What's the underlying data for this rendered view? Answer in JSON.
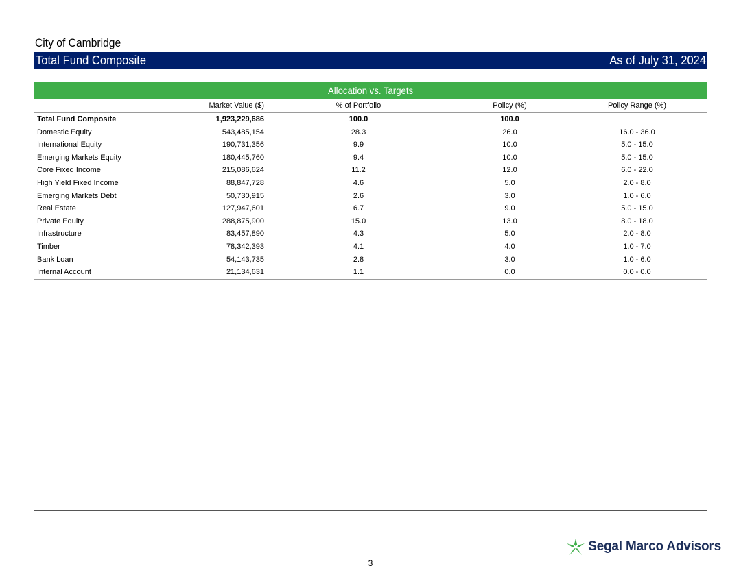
{
  "header": {
    "client_name": "City of Cambridge",
    "title": "Total Fund Composite",
    "as_of": "As of July 31, 2024"
  },
  "allocation": {
    "section_title": "Allocation vs. Targets",
    "columns": [
      "",
      "Market Value ($)",
      "% of Portfolio",
      "Policy (%)",
      "Policy Range (%)"
    ],
    "total": {
      "name": "Total Fund Composite",
      "market_value": "1,923,229,686",
      "pct_portfolio": "100.0",
      "policy": "100.0",
      "range": ""
    },
    "rows": [
      {
        "name": "Domestic Equity",
        "market_value": "543,485,154",
        "pct_portfolio": "28.3",
        "policy": "26.0",
        "range": "16.0 - 36.0"
      },
      {
        "name": "International Equity",
        "market_value": "190,731,356",
        "pct_portfolio": "9.9",
        "policy": "10.0",
        "range": "5.0 - 15.0"
      },
      {
        "name": "Emerging Markets Equity",
        "market_value": "180,445,760",
        "pct_portfolio": "9.4",
        "policy": "10.0",
        "range": "5.0 - 15.0"
      },
      {
        "name": "Core Fixed Income",
        "market_value": "215,086,624",
        "pct_portfolio": "11.2",
        "policy": "12.0",
        "range": "6.0 - 22.0"
      },
      {
        "name": "High Yield Fixed Income",
        "market_value": "88,847,728",
        "pct_portfolio": "4.6",
        "policy": "5.0",
        "range": "2.0 - 8.0"
      },
      {
        "name": "Emerging Markets Debt",
        "market_value": "50,730,915",
        "pct_portfolio": "2.6",
        "policy": "3.0",
        "range": "1.0 - 6.0"
      },
      {
        "name": "Real Estate",
        "market_value": "127,947,601",
        "pct_portfolio": "6.7",
        "policy": "9.0",
        "range": "5.0 - 15.0"
      },
      {
        "name": "Private Equity",
        "market_value": "288,875,900",
        "pct_portfolio": "15.0",
        "policy": "13.0",
        "range": "8.0 - 18.0"
      },
      {
        "name": "Infrastructure",
        "market_value": "83,457,890",
        "pct_portfolio": "4.3",
        "policy": "5.0",
        "range": "2.0 - 8.0"
      },
      {
        "name": "Timber",
        "market_value": "78,342,393",
        "pct_portfolio": "4.1",
        "policy": "4.0",
        "range": "1.0 - 7.0"
      },
      {
        "name": "Bank Loan",
        "market_value": "54,143,735",
        "pct_portfolio": "2.8",
        "policy": "3.0",
        "range": "1.0 - 6.0"
      },
      {
        "name": "Internal Account",
        "market_value": "21,134,631",
        "pct_portfolio": "1.1",
        "policy": "0.0",
        "range": "0.0 - 0.0"
      }
    ]
  },
  "footer": {
    "logo_text": "Segal Marco Advisors",
    "logo_icon": "star-icon",
    "page_number": "3"
  },
  "colors": {
    "title_bar": "#001f6b",
    "section_header": "#3fae49",
    "logo_text": "#1d2f5a",
    "logo_icon": "#3fae49"
  }
}
